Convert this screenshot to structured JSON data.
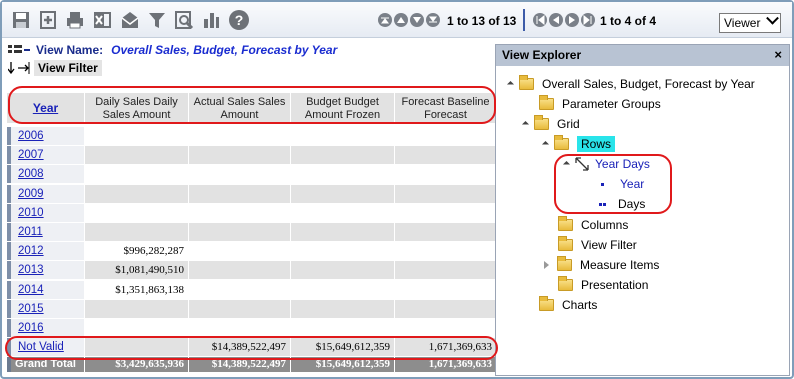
{
  "toolbar": {
    "icons": [
      "save-icon",
      "add-icon",
      "print-icon",
      "excel-icon",
      "email-icon",
      "filter-icon",
      "find-icon",
      "chart-icon",
      "help-icon"
    ],
    "rows_paging": "1 to 13 of 13",
    "cols_paging": "1 to 4 of 4",
    "viewer_label": "Viewer"
  },
  "view": {
    "name_label": "View Name:",
    "name_value": "Overall Sales, Budget, Forecast by Year",
    "filter_label": "View Filter"
  },
  "grid": {
    "headers": [
      "Year",
      "Daily Sales Daily Sales Amount",
      "Actual Sales Sales Amount",
      "Budget Budget Amount Frozen",
      "Forecast Baseline Forecast"
    ],
    "rows": [
      {
        "year": "2006",
        "values": [
          "",
          "",
          "",
          ""
        ]
      },
      {
        "year": "2007",
        "values": [
          "",
          "",
          "",
          ""
        ]
      },
      {
        "year": "2008",
        "values": [
          "",
          "",
          "",
          ""
        ]
      },
      {
        "year": "2009",
        "values": [
          "",
          "",
          "",
          ""
        ]
      },
      {
        "year": "2010",
        "values": [
          "",
          "",
          "",
          ""
        ]
      },
      {
        "year": "2011",
        "values": [
          "",
          "",
          "",
          ""
        ]
      },
      {
        "year": "2012",
        "values": [
          "$996,282,287",
          "",
          "",
          ""
        ]
      },
      {
        "year": "2013",
        "values": [
          "$1,081,490,510",
          "",
          "",
          ""
        ]
      },
      {
        "year": "2014",
        "values": [
          "$1,351,863,138",
          "",
          "",
          ""
        ]
      },
      {
        "year": "2015",
        "values": [
          "",
          "",
          "",
          ""
        ]
      },
      {
        "year": "2016",
        "values": [
          "",
          "",
          "",
          ""
        ]
      },
      {
        "year": "Not Valid",
        "values": [
          "",
          "$14,389,522,497",
          "$15,649,612,359",
          "1,671,369,633"
        ]
      }
    ],
    "total": {
      "label": "Grand Total",
      "values": [
        "$3,429,635,936",
        "$14,389,522,497",
        "$15,649,612,359",
        "1,671,369,633"
      ]
    }
  },
  "explorer": {
    "title": "View Explorer",
    "close": "×",
    "root": "Overall Sales, Budget, Forecast by Year",
    "parameter_groups": "Parameter Groups",
    "grid": "Grid",
    "rows": "Rows",
    "year_days": "Year Days",
    "year": "Year",
    "days": "Days",
    "columns": "Columns",
    "view_filter": "View Filter",
    "measure_items": "Measure Items",
    "presentation": "Presentation",
    "charts": "Charts"
  },
  "colors": {
    "accent_red": "#e0191b",
    "link_blue": "#1a22b8",
    "rows_highlight": "#29e4ea"
  }
}
